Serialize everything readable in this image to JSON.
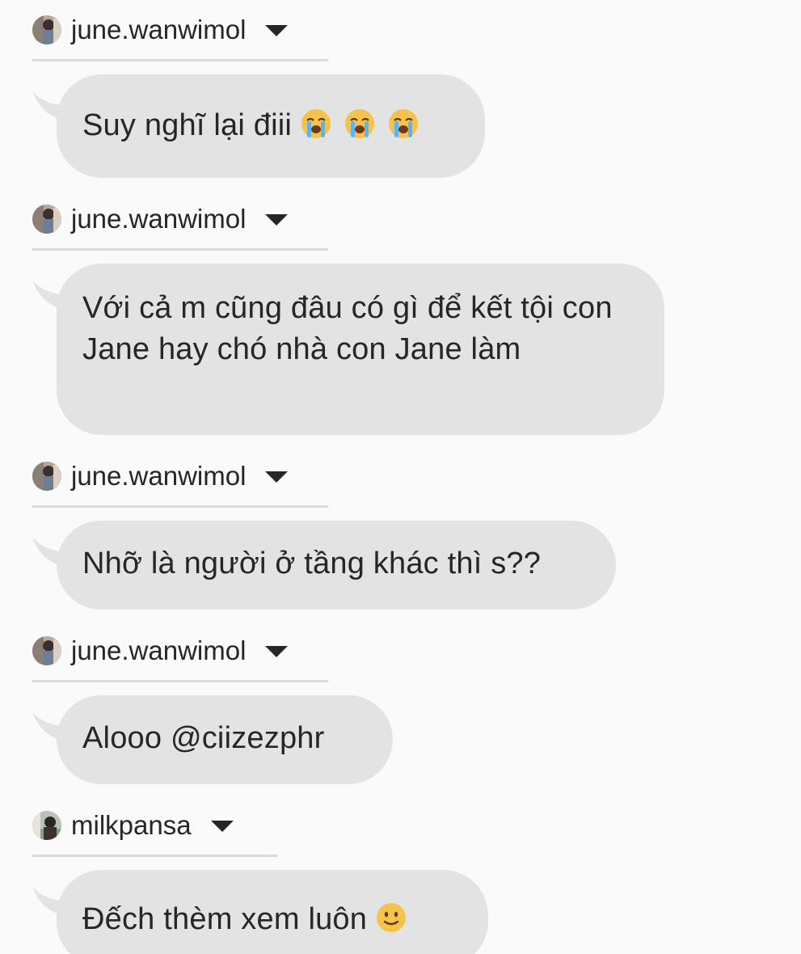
{
  "messages": [
    {
      "sender": "june.wanwimol",
      "text": "Suy nghĩ lại điii",
      "emojis": [
        "loudly-crying-face-icon",
        "loudly-crying-face-icon",
        "loudly-crying-face-icon"
      ]
    },
    {
      "sender": "june.wanwimol",
      "text": "Với cả m cũng đâu có gì để kết tội con Jane hay chó nhà con Jane làm",
      "emojis": []
    },
    {
      "sender": "june.wanwimol",
      "text": "Nhỡ là người ở tầng khác thì s??",
      "emojis": []
    },
    {
      "sender": "june.wanwimol",
      "text": "Alooo @ciizezphr",
      "emojis": []
    },
    {
      "sender": "milkpansa",
      "text": "Đếch thèm xem luôn",
      "emojis": [
        "slightly-smiling-face-icon"
      ]
    }
  ],
  "colors": {
    "background": "#fafafa",
    "bubble": "#e3e3e3",
    "divider": "#dbdbdb",
    "text": "#262626"
  }
}
